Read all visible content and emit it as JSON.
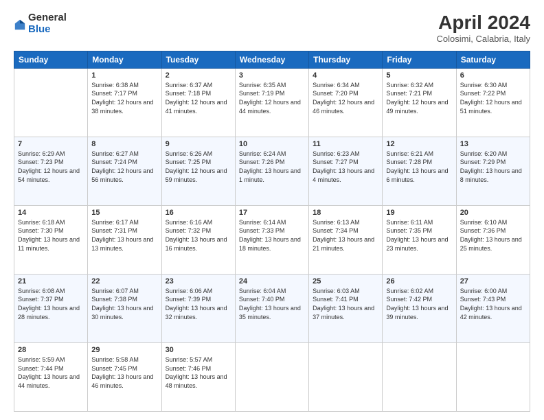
{
  "header": {
    "logo_general": "General",
    "logo_blue": "Blue",
    "month": "April 2024",
    "location": "Colosimi, Calabria, Italy"
  },
  "days_of_week": [
    "Sunday",
    "Monday",
    "Tuesday",
    "Wednesday",
    "Thursday",
    "Friday",
    "Saturday"
  ],
  "weeks": [
    [
      {
        "num": "",
        "sunrise": "",
        "sunset": "",
        "daylight": ""
      },
      {
        "num": "1",
        "sunrise": "Sunrise: 6:38 AM",
        "sunset": "Sunset: 7:17 PM",
        "daylight": "Daylight: 12 hours and 38 minutes."
      },
      {
        "num": "2",
        "sunrise": "Sunrise: 6:37 AM",
        "sunset": "Sunset: 7:18 PM",
        "daylight": "Daylight: 12 hours and 41 minutes."
      },
      {
        "num": "3",
        "sunrise": "Sunrise: 6:35 AM",
        "sunset": "Sunset: 7:19 PM",
        "daylight": "Daylight: 12 hours and 44 minutes."
      },
      {
        "num": "4",
        "sunrise": "Sunrise: 6:34 AM",
        "sunset": "Sunset: 7:20 PM",
        "daylight": "Daylight: 12 hours and 46 minutes."
      },
      {
        "num": "5",
        "sunrise": "Sunrise: 6:32 AM",
        "sunset": "Sunset: 7:21 PM",
        "daylight": "Daylight: 12 hours and 49 minutes."
      },
      {
        "num": "6",
        "sunrise": "Sunrise: 6:30 AM",
        "sunset": "Sunset: 7:22 PM",
        "daylight": "Daylight: 12 hours and 51 minutes."
      }
    ],
    [
      {
        "num": "7",
        "sunrise": "Sunrise: 6:29 AM",
        "sunset": "Sunset: 7:23 PM",
        "daylight": "Daylight: 12 hours and 54 minutes."
      },
      {
        "num": "8",
        "sunrise": "Sunrise: 6:27 AM",
        "sunset": "Sunset: 7:24 PM",
        "daylight": "Daylight: 12 hours and 56 minutes."
      },
      {
        "num": "9",
        "sunrise": "Sunrise: 6:26 AM",
        "sunset": "Sunset: 7:25 PM",
        "daylight": "Daylight: 12 hours and 59 minutes."
      },
      {
        "num": "10",
        "sunrise": "Sunrise: 6:24 AM",
        "sunset": "Sunset: 7:26 PM",
        "daylight": "Daylight: 13 hours and 1 minute."
      },
      {
        "num": "11",
        "sunrise": "Sunrise: 6:23 AM",
        "sunset": "Sunset: 7:27 PM",
        "daylight": "Daylight: 13 hours and 4 minutes."
      },
      {
        "num": "12",
        "sunrise": "Sunrise: 6:21 AM",
        "sunset": "Sunset: 7:28 PM",
        "daylight": "Daylight: 13 hours and 6 minutes."
      },
      {
        "num": "13",
        "sunrise": "Sunrise: 6:20 AM",
        "sunset": "Sunset: 7:29 PM",
        "daylight": "Daylight: 13 hours and 8 minutes."
      }
    ],
    [
      {
        "num": "14",
        "sunrise": "Sunrise: 6:18 AM",
        "sunset": "Sunset: 7:30 PM",
        "daylight": "Daylight: 13 hours and 11 minutes."
      },
      {
        "num": "15",
        "sunrise": "Sunrise: 6:17 AM",
        "sunset": "Sunset: 7:31 PM",
        "daylight": "Daylight: 13 hours and 13 minutes."
      },
      {
        "num": "16",
        "sunrise": "Sunrise: 6:16 AM",
        "sunset": "Sunset: 7:32 PM",
        "daylight": "Daylight: 13 hours and 16 minutes."
      },
      {
        "num": "17",
        "sunrise": "Sunrise: 6:14 AM",
        "sunset": "Sunset: 7:33 PM",
        "daylight": "Daylight: 13 hours and 18 minutes."
      },
      {
        "num": "18",
        "sunrise": "Sunrise: 6:13 AM",
        "sunset": "Sunset: 7:34 PM",
        "daylight": "Daylight: 13 hours and 21 minutes."
      },
      {
        "num": "19",
        "sunrise": "Sunrise: 6:11 AM",
        "sunset": "Sunset: 7:35 PM",
        "daylight": "Daylight: 13 hours and 23 minutes."
      },
      {
        "num": "20",
        "sunrise": "Sunrise: 6:10 AM",
        "sunset": "Sunset: 7:36 PM",
        "daylight": "Daylight: 13 hours and 25 minutes."
      }
    ],
    [
      {
        "num": "21",
        "sunrise": "Sunrise: 6:08 AM",
        "sunset": "Sunset: 7:37 PM",
        "daylight": "Daylight: 13 hours and 28 minutes."
      },
      {
        "num": "22",
        "sunrise": "Sunrise: 6:07 AM",
        "sunset": "Sunset: 7:38 PM",
        "daylight": "Daylight: 13 hours and 30 minutes."
      },
      {
        "num": "23",
        "sunrise": "Sunrise: 6:06 AM",
        "sunset": "Sunset: 7:39 PM",
        "daylight": "Daylight: 13 hours and 32 minutes."
      },
      {
        "num": "24",
        "sunrise": "Sunrise: 6:04 AM",
        "sunset": "Sunset: 7:40 PM",
        "daylight": "Daylight: 13 hours and 35 minutes."
      },
      {
        "num": "25",
        "sunrise": "Sunrise: 6:03 AM",
        "sunset": "Sunset: 7:41 PM",
        "daylight": "Daylight: 13 hours and 37 minutes."
      },
      {
        "num": "26",
        "sunrise": "Sunrise: 6:02 AM",
        "sunset": "Sunset: 7:42 PM",
        "daylight": "Daylight: 13 hours and 39 minutes."
      },
      {
        "num": "27",
        "sunrise": "Sunrise: 6:00 AM",
        "sunset": "Sunset: 7:43 PM",
        "daylight": "Daylight: 13 hours and 42 minutes."
      }
    ],
    [
      {
        "num": "28",
        "sunrise": "Sunrise: 5:59 AM",
        "sunset": "Sunset: 7:44 PM",
        "daylight": "Daylight: 13 hours and 44 minutes."
      },
      {
        "num": "29",
        "sunrise": "Sunrise: 5:58 AM",
        "sunset": "Sunset: 7:45 PM",
        "daylight": "Daylight: 13 hours and 46 minutes."
      },
      {
        "num": "30",
        "sunrise": "Sunrise: 5:57 AM",
        "sunset": "Sunset: 7:46 PM",
        "daylight": "Daylight: 13 hours and 48 minutes."
      },
      {
        "num": "",
        "sunrise": "",
        "sunset": "",
        "daylight": ""
      },
      {
        "num": "",
        "sunrise": "",
        "sunset": "",
        "daylight": ""
      },
      {
        "num": "",
        "sunrise": "",
        "sunset": "",
        "daylight": ""
      },
      {
        "num": "",
        "sunrise": "",
        "sunset": "",
        "daylight": ""
      }
    ]
  ]
}
